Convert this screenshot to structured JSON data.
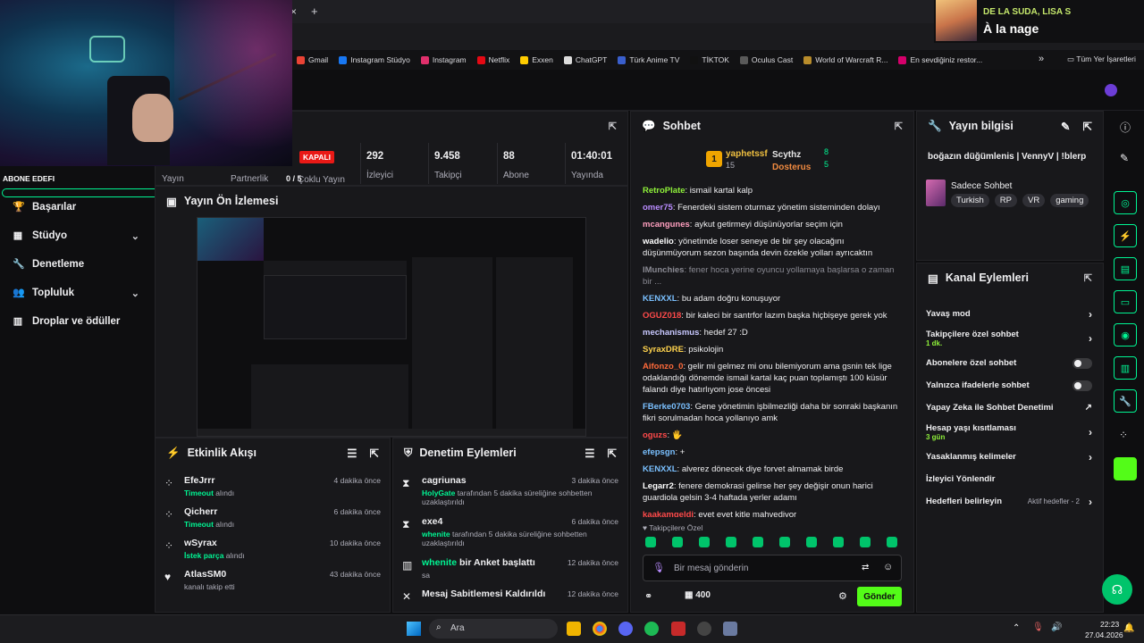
{
  "browser": {
    "bookmarks": [
      {
        "label": "Gmail",
        "color": "#ea4335"
      },
      {
        "label": "Instagram Stüdyo",
        "color": "#1877f2"
      },
      {
        "label": "Instagram",
        "color": "#e1306c"
      },
      {
        "label": "Netflix",
        "color": "#e50914"
      },
      {
        "label": "Exxen",
        "color": "#ffcc00"
      },
      {
        "label": "ChatGPT",
        "color": "#dddddd"
      },
      {
        "label": "Türk Anime TV",
        "color": "#3a5fcd"
      },
      {
        "label": "TİKTOK",
        "color": "#111111"
      },
      {
        "label": "Oculus Cast",
        "color": "#5a5a5a"
      },
      {
        "label": "World of Warcraft R...",
        "color": "#b88c2b"
      },
      {
        "label": "En sevdiğiniz restor...",
        "color": "#d6006b"
      }
    ],
    "bookmarks_more": "»",
    "all_bookmarks": "Tüm Yer İşaretleri",
    "tab_close": "×",
    "tab_new": "+"
  },
  "music": {
    "artist": "DE LA SUDA, LISA S",
    "track": "À la nage"
  },
  "overlay": {
    "user_tag": "ABONE EDEFI"
  },
  "sidebar": {
    "items": [
      {
        "label": "Başarılar",
        "icon": "trophy-icon",
        "chevron": false
      },
      {
        "label": "Stüdyo",
        "icon": "studio-icon",
        "chevron": true
      },
      {
        "label": "Denetleme",
        "icon": "wrench-icon",
        "chevron": false
      },
      {
        "label": "Topluluk",
        "icon": "community-icon",
        "chevron": true
      },
      {
        "label": "Droplar ve ödüller",
        "icon": "drops-icon",
        "chevron": false
      }
    ]
  },
  "stream_header": {
    "cells": [
      {
        "label": "Yayın",
        "value": ""
      },
      {
        "label": "Partnerlik",
        "value": "0 / 5"
      },
      {
        "label": "Çoklu Yayın",
        "value": ""
      }
    ],
    "status_badge": "KAPALI",
    "stats": [
      {
        "value": "292",
        "label": "İzleyici"
      },
      {
        "value": "9.458",
        "label": "Takipçi"
      },
      {
        "value": "88",
        "label": "Abone"
      },
      {
        "value": "01:40:01",
        "label": "Yayında"
      }
    ]
  },
  "preview": {
    "title": "Yayın Ön İzlemesi"
  },
  "activity": {
    "title": "Etkinlik Akışı",
    "events": [
      {
        "name": "EfeJrrr",
        "highlight": "Timeout",
        "rest": " alındı",
        "time": "4 dakika önce",
        "icon": "users-icon"
      },
      {
        "name": "Qicherr",
        "highlight": "Timeout",
        "rest": " alındı",
        "time": "6 dakika önce",
        "icon": "users-icon"
      },
      {
        "name": "wSyrax",
        "highlight": "İstek parça",
        "rest": " alındı",
        "time": "10 dakika önce",
        "icon": "users-icon"
      },
      {
        "name": "AtlasSM0",
        "highlight": "",
        "rest": "kanalı takip etti",
        "time": "43 dakika önce",
        "icon": "heart-icon"
      }
    ]
  },
  "mod_actions": {
    "title": "Denetim Eylemleri",
    "events": [
      {
        "name": "cagriunas",
        "actor": "HolyGate",
        "desc": " tarafından 5 dakika süreliğine sohbetten uzaklaştırıldı",
        "time": "3 dakika önce",
        "icon": "hourglass-icon"
      },
      {
        "name": "exe4",
        "actor": "whenite",
        "desc": " tarafından 5 dakika süreliğine sohbetten uzaklaştırıldı",
        "time": "6 dakika önce",
        "icon": "hourglass-icon"
      },
      {
        "name": "whenite",
        "actor": "",
        "desc": "sa",
        "name_suffix": " bir Anket başlattı",
        "time": "12 dakika önce",
        "icon": "poll-icon"
      },
      {
        "name": "Mesaj Sabitlemesi Kaldırıldı",
        "actor": "",
        "desc": "",
        "time": "12 dakika önce",
        "icon": "unpin-icon"
      }
    ]
  },
  "chat": {
    "title": "Sohbet",
    "top_gifters": [
      {
        "name": "yaphetssf",
        "count": "15",
        "rank": "1"
      },
      {
        "name": "Scythz",
        "count": "8",
        "rank": ""
      },
      {
        "name": "Dosterus",
        "count": "5",
        "rank": ""
      }
    ],
    "messages": [
      {
        "user": "RetroPlate",
        "color": "#8ff13a",
        "text": ": ismail kartal kalp"
      },
      {
        "user": "omer75",
        "color": "#b98cff",
        "text": ": Fenerdeki sistem oturmaz yönetim sisteminden dolayı"
      },
      {
        "user": "mcangunes",
        "color": "#ff9fbf",
        "text": ": aykut getirmeyi düşünüyorlar seçim için"
      },
      {
        "user": "wadelio",
        "color": "#ffffff",
        "text": ": yönetimde loser seneye de bir şey olacağını düşünmüyorum sezon başında devin özekle yolları ayrıcaktın"
      },
      {
        "user": "IMunchies",
        "color": "#8a8a93",
        "text": ": fener hoca yerine oyuncu yollamaya başlarsa o zaman bir ..."
      },
      {
        "user": "KENXXL",
        "color": "#7ac0ff",
        "text": ": bu adam doğru konuşuyor"
      },
      {
        "user": "OGUZ018",
        "color": "#ff4a4a",
        "text": ": bir kaleci bir santrfor lazım başka hiçbişeye gerek yok"
      },
      {
        "user": "mechanismus",
        "color": "#c8c8ff",
        "text": ": hedef 27 :D"
      },
      {
        "user": "SyraxDRE",
        "color": "#ffd34d",
        "text": ": psikolojin"
      },
      {
        "user": "Aifonzo_0",
        "color": "#ff6a3a",
        "text": ": gelir mi gelmez mi onu bilemiyorum ama gsnin tek lige odaklandığı dönemde ismail kartal kaç puan toplamıştı 100 küsür falandı diye hatırlıyom jose öncesi"
      },
      {
        "user": "FBerke0703",
        "color": "#7ac0ff",
        "text": ": Gene yönetimin işbilmezliği daha bir sonraki başkanın fikri sorulmadan hoca yollanıyo amk"
      },
      {
        "user": "oguzs",
        "color": "#ff4a4a",
        "text": ": 🖐"
      },
      {
        "user": "efepsgn",
        "color": "#7ac0ff",
        "text": ": +"
      },
      {
        "user": "KENXXL",
        "color": "#7ac0ff",
        "text": ": alverez dönecek diye forvet almamak birde"
      },
      {
        "user": "Legarr2",
        "color": "#ffffff",
        "text": ": fenere demokrasi gelirse her şey değişir onun harici guardiola gelsin 3-4 haftada yerler adamı"
      },
      {
        "user": "kaakamgeldi",
        "color": "#ff4a4a",
        "text": ": evet evet kitle mahvediyor"
      }
    ],
    "mode": "Takipçilere Özel",
    "input_placeholder": "Bir mesaj gönderin",
    "points": "400",
    "send_label": "Gönder"
  },
  "stream_info": {
    "title": "Yayın bilgisi",
    "stream_title": "boğazın düğümlenis | VennyV | !blerp",
    "category": "Sadece Sohbet",
    "tags": [
      "Turkish",
      "RP",
      "VR",
      "gaming"
    ]
  },
  "channel_actions": {
    "title": "Kanal Eylemleri",
    "items": [
      {
        "label": "Yavaş mod",
        "sub": "",
        "control": "arrow"
      },
      {
        "label": "Takipçilere özel sohbet",
        "sub": "1 dk.",
        "control": "arrow"
      },
      {
        "label": "Abonelere özel sohbet",
        "sub": "",
        "control": "toggle"
      },
      {
        "label": "Yalnızca ifadelerle sohbet",
        "sub": "",
        "control": "toggle"
      },
      {
        "label": "Yapay Zeka ile Sohbet Denetimi",
        "sub": "",
        "control": "external"
      },
      {
        "label": "Hesap yaşı kısıtlaması",
        "sub": "3 gün",
        "control": "arrow"
      },
      {
        "label": "Yasaklanmış kelimeler",
        "sub": "",
        "control": "arrow"
      },
      {
        "label": "İzleyici Yönlendir",
        "sub": "",
        "control": "none"
      },
      {
        "label": "Hedefleri belirleyin",
        "sub": "",
        "control": "arrow",
        "aside": "Aktif hedefler - 2"
      }
    ]
  },
  "taskbar": {
    "search_placeholder": "Ara",
    "time": "22:23",
    "date": "27.04.2026"
  },
  "colors": {
    "accent": "#00f593",
    "send_button": "#53fc18",
    "badge_red": "#e91916"
  }
}
